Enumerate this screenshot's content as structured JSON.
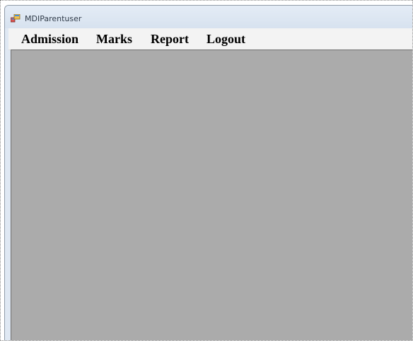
{
  "window": {
    "title": "MDIParentuser"
  },
  "menu": {
    "items": [
      {
        "label": "Admission"
      },
      {
        "label": "Marks"
      },
      {
        "label": "Report"
      },
      {
        "label": "Logout"
      }
    ]
  },
  "icons": {
    "app_icon": "windows-form-icon"
  },
  "colors": {
    "mdi_client_background": "#ababab",
    "menubar_background": "#f3f3f3",
    "titlebar_background": "#dfe8f3"
  }
}
